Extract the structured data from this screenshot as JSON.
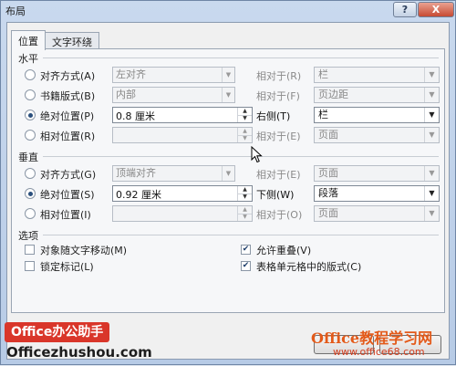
{
  "window": {
    "title": "布局",
    "help_label": "?",
    "close_label": "X"
  },
  "tabs": [
    {
      "label": "位置",
      "active": true
    },
    {
      "label": "文字环绕",
      "active": false
    }
  ],
  "horizontal": {
    "heading": "水平",
    "rows": [
      {
        "label": "对齐方式(A)",
        "selected": false,
        "field": "左对齐",
        "rel_label": "相对于(R)",
        "rel_value": "栏"
      },
      {
        "label": "书籍版式(B)",
        "selected": false,
        "field": "内部",
        "rel_label": "相对于(F)",
        "rel_value": "页边距"
      },
      {
        "label": "绝对位置(P)",
        "selected": true,
        "field": "0.8 厘米",
        "rel_label": "右侧(T)",
        "rel_value": "栏"
      },
      {
        "label": "相对位置(R)",
        "selected": false,
        "field": "",
        "rel_label": "相对于(E)",
        "rel_value": "页面"
      }
    ]
  },
  "vertical": {
    "heading": "垂直",
    "rows": [
      {
        "label": "对齐方式(G)",
        "selected": false,
        "field": "顶端对齐",
        "rel_label": "相对于(E)",
        "rel_value": "页面"
      },
      {
        "label": "绝对位置(S)",
        "selected": true,
        "field": "0.92 厘米",
        "rel_label": "下侧(W)",
        "rel_value": "段落"
      },
      {
        "label": "相对位置(I)",
        "selected": false,
        "field": "",
        "rel_label": "相对于(O)",
        "rel_value": "页面"
      }
    ]
  },
  "options": {
    "heading": "选项",
    "move_with_text": {
      "label": "对象随文字移动(M)",
      "checked": false
    },
    "lock_anchor": {
      "label": "锁定标记(L)",
      "checked": false
    },
    "allow_overlap": {
      "label": "允许重叠(V)",
      "checked": true
    },
    "layout_in_cell": {
      "label": "表格单元格中的版式(C)",
      "checked": true
    }
  },
  "watermarks": {
    "left_badge": "Office办公助手",
    "left_url": "Officezhushou.com",
    "right_brand": "Office教程学习网",
    "right_site": "www.office68.com"
  }
}
